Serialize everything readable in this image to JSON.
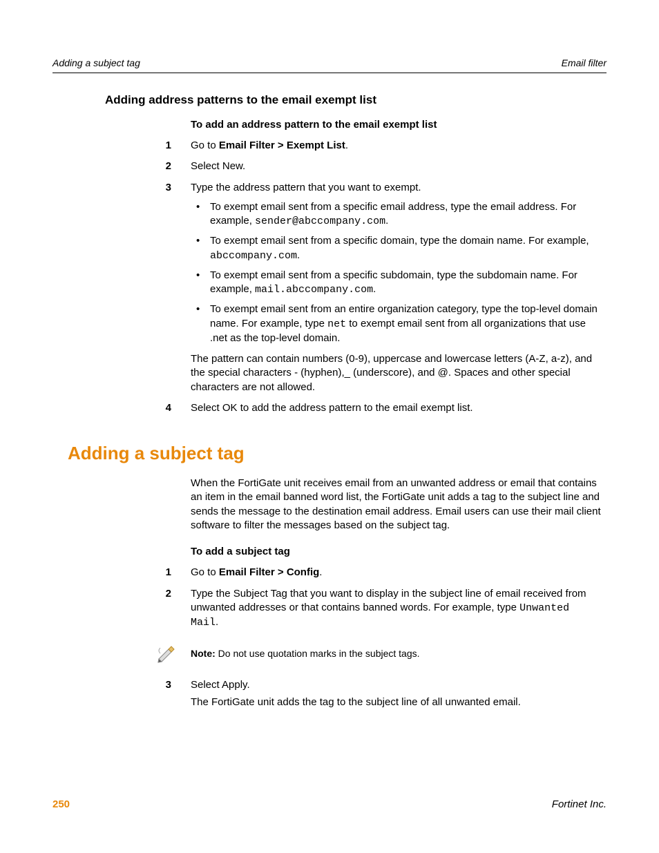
{
  "header": {
    "left": "Adding a subject tag",
    "right": "Email filter"
  },
  "section1": {
    "heading": "Adding address patterns to the email exempt list",
    "proc_title": "To add an address pattern to the email exempt list",
    "steps": {
      "n1": "1",
      "s1_a": "Go to ",
      "s1_b": "Email Filter > Exempt List",
      "s1_c": ".",
      "n2": "2",
      "s2": "Select New.",
      "n3": "3",
      "s3": "Type the address pattern that you want to exempt.",
      "b1_a": "To exempt email sent from a specific email address, type the email address. For example, ",
      "b1_b": "sender@abccompany.com",
      "b1_c": ".",
      "b2_a": "To exempt email sent from a specific domain, type the domain name. For example, ",
      "b2_b": "abccompany.com",
      "b2_c": ".",
      "b3_a": "To exempt email sent from a specific subdomain, type the subdomain name. For example, ",
      "b3_b": "mail.abccompany.com",
      "b3_c": ".",
      "b4_a": "To exempt email sent from an entire organization category, type the top-level domain name. For example, type ",
      "b4_b": "net",
      "b4_c": " to exempt email sent from all organizations that use .net as the top-level domain.",
      "s3_tail": "The pattern can contain numbers (0-9), uppercase and lowercase letters (A-Z, a-z), and the special characters - (hyphen),_ (underscore), and @. Spaces and other special characters are not allowed.",
      "n4": "4",
      "s4": "Select OK to add the address pattern to the email exempt list."
    }
  },
  "section2": {
    "heading": "Adding a subject tag",
    "intro": "When the FortiGate unit receives email from an unwanted address or email that contains an item in the email banned word list, the FortiGate unit adds a tag to the subject line and sends the message to the destination email address. Email users can use their mail client software to filter the messages based on the subject tag.",
    "proc_title": "To add a subject tag",
    "steps": {
      "n1": "1",
      "s1_a": "Go to ",
      "s1_b": "Email Filter > Config",
      "s1_c": ".",
      "n2": "2",
      "s2_a": "Type the Subject Tag that you want to display in the subject line of email received from unwanted addresses or that contains banned words. For example, type ",
      "s2_b": "Unwanted Mail",
      "s2_c": ".",
      "note_label": "Note:",
      "note_body": " Do not use quotation marks in the subject tags.",
      "n3": "3",
      "s3": "Select Apply.",
      "s3_tail": "The FortiGate unit adds the tag to the subject line of all unwanted email."
    }
  },
  "footer": {
    "page": "250",
    "right": "Fortinet Inc."
  }
}
